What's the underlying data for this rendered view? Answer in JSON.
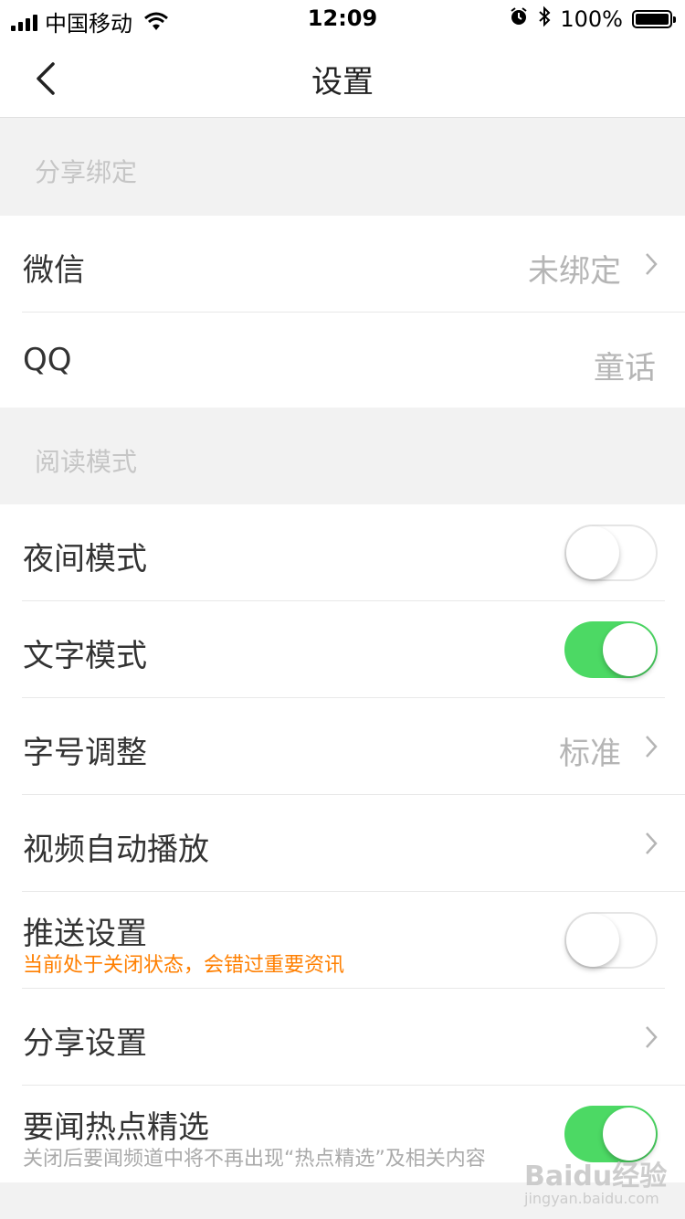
{
  "status_bar": {
    "carrier": "中国移动",
    "time": "12:09",
    "battery": "100%"
  },
  "nav": {
    "title": "设置"
  },
  "sections": {
    "share_binding": "分享绑定",
    "reading_mode": "阅读模式"
  },
  "rows": {
    "wechat": {
      "label": "微信",
      "value": "未绑定"
    },
    "qq": {
      "label": "QQ",
      "value": "童话"
    },
    "night_mode": {
      "label": "夜间模式",
      "on": false
    },
    "text_mode": {
      "label": "文字模式",
      "on": true
    },
    "font_size": {
      "label": "字号调整",
      "value": "标准"
    },
    "video_autoplay": {
      "label": "视频自动播放"
    },
    "push": {
      "label": "推送设置",
      "hint": "当前处于关闭状态，会错过重要资讯",
      "on": false
    },
    "share_settings": {
      "label": "分享设置"
    },
    "hot_picks": {
      "label": "要闻热点精选",
      "hint": "关闭后要闻频道中将不再出现“热点精选”及相关内容",
      "on": true
    }
  },
  "watermark": {
    "brand": "Baidu经验",
    "url": "jingyan.baidu.com"
  },
  "colors": {
    "toggle_on": "#4cd964",
    "hint_orange": "#ff7f00"
  }
}
